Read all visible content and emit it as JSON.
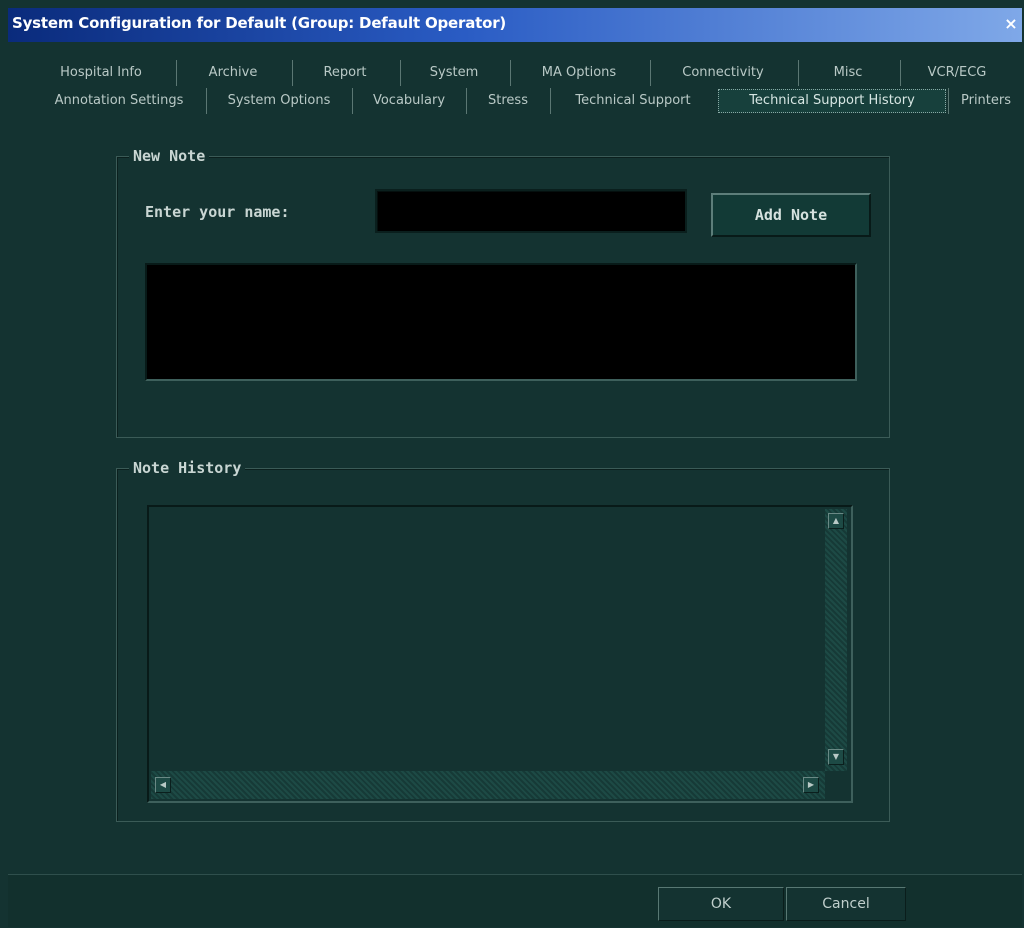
{
  "window": {
    "title": "System Configuration for Default (Group: Default Operator)",
    "close_glyph": "×"
  },
  "tabs_row1": [
    {
      "label": "Hospital Info"
    },
    {
      "label": "Archive"
    },
    {
      "label": "Report"
    },
    {
      "label": "System"
    },
    {
      "label": "MA Options"
    },
    {
      "label": "Connectivity"
    },
    {
      "label": "Misc"
    },
    {
      "label": "VCR/ECG"
    }
  ],
  "tabs_row2": [
    {
      "label": "Annotation Settings"
    },
    {
      "label": "System Options"
    },
    {
      "label": "Vocabulary"
    },
    {
      "label": "Stress"
    },
    {
      "label": "Technical Support"
    },
    {
      "label": "Technical Support History",
      "active": true
    },
    {
      "label": "Printers"
    }
  ],
  "new_note": {
    "legend": "New Note",
    "name_label": "Enter your name:",
    "name_value": "",
    "add_button": "Add Note",
    "note_text": ""
  },
  "note_history": {
    "legend": "Note History",
    "content": ""
  },
  "footer": {
    "ok_label": "OK",
    "cancel_label": "Cancel"
  },
  "colors": {
    "background": "#143331",
    "titlebar_start": "#0a2b7c",
    "titlebar_end": "#7fa8e8",
    "input_bg": "#000000"
  },
  "icons": {
    "close": "close-icon",
    "scroll_up": "arrow-up-icon",
    "scroll_down": "arrow-down-icon",
    "scroll_left": "arrow-left-icon",
    "scroll_right": "arrow-right-icon"
  }
}
